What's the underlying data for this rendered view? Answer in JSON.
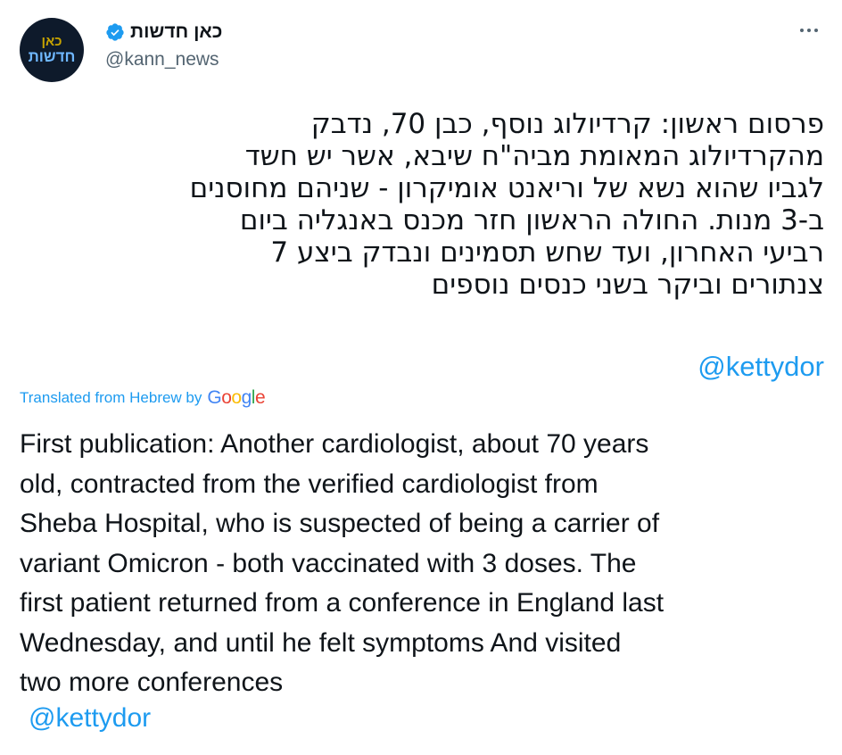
{
  "account": {
    "display_name": "כאן חדשות",
    "handle": "@kann_news",
    "verified": true,
    "avatar_text_line1_a": "כאן",
    "avatar_text_line2": "חדשות",
    "avatar_bg": "#0e1a2b"
  },
  "menu": {
    "icon": "more-horizontal-icon"
  },
  "tweet": {
    "hebrew_lines": [
      "פרסום ראשון: קרדיולוג נוסף, כבן 70, נדבק",
      "מהקרדיולוג המאומת מביה\"ח שיבא, אשר יש חשד",
      "לגביו שהוא נשא של וריאנט אומיקרון - שניהם מחוסנים",
      "ב-3 מנות. החולה הראשון חזר מכנס באנגליה ביום",
      "רביעי האחרון, ועד שחש תסמינים ונבדק ביצע 7",
      "צנתורים וביקר בשני כנסים נוספים"
    ],
    "hebrew_mention": "@kettydor",
    "translated_label": "Translated from Hebrew by",
    "google_word": "Google",
    "english_lines": [
      "First publication: Another cardiologist, about 70 years",
      "old, contracted from the verified cardiologist from",
      "Sheba Hospital, who is suspected of being a carrier of",
      "variant Omicron - both vaccinated with 3 doses. The",
      "first patient returned from a conference in England last",
      "Wednesday, and until he felt symptoms And visited",
      "two more conferences"
    ],
    "english_mention": "@kettydor"
  },
  "colors": {
    "link": "#1d9bf0",
    "text": "#0f1419",
    "secondary": "#536471",
    "verified": "#1d9bf0"
  }
}
